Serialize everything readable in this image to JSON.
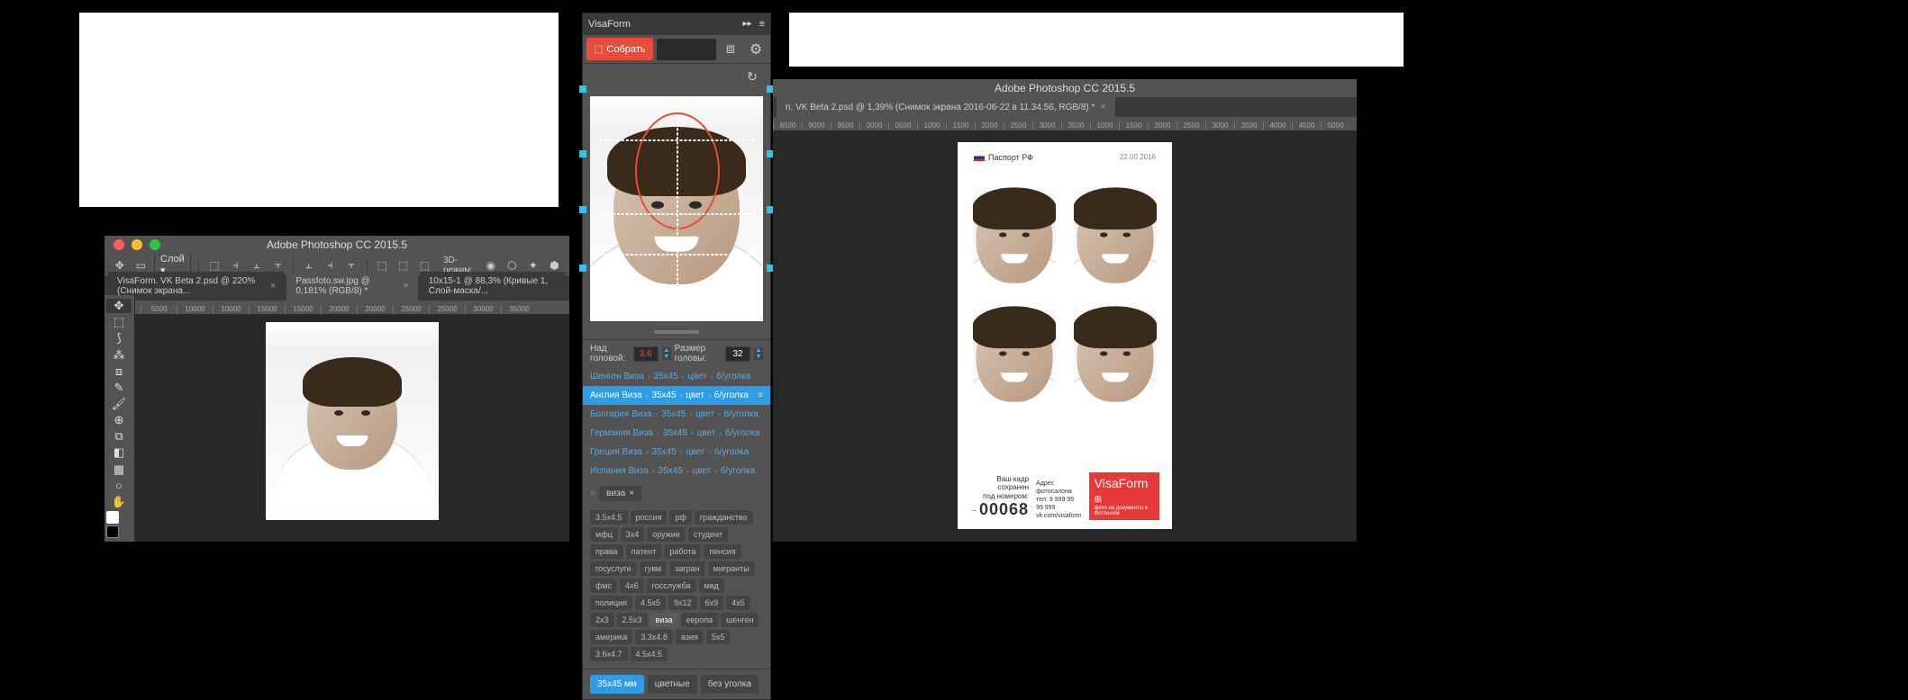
{
  "white_boxes": {},
  "ps_left": {
    "title": "Adobe Photoshop CC 2015.5",
    "layer_label": "Слой",
    "mode_label": "3D-режим:",
    "tabs": [
      "VisaForm. VK Beta 2.psd @ 220% (Снимок экрана...",
      "Passfoto.sw.jpg @ 0,181% (RGB/8) *",
      "10x15-1 @ 88,3% (Кривые 1, Слой-маска/..."
    ],
    "ruler": [
      "5000",
      "5000",
      "10000",
      "10000",
      "15000",
      "15000",
      "20000",
      "20000",
      "25000",
      "25000",
      "30000",
      "35000"
    ]
  },
  "ps_right": {
    "title": "Adobe Photoshop CC 2015.5",
    "tab": "n. VK Beta 2.psd @ 1,39% (Снимок экрана 2016-06-22 в 11.34.56, RGB/8) *",
    "ruler": [
      "8500",
      "9000",
      "9500",
      "0000",
      "0500",
      "1000",
      "1500",
      "2000",
      "2500",
      "3000",
      "3500",
      "1000",
      "1500",
      "2000",
      "2500",
      "3000",
      "3500",
      "4000",
      "4500",
      "5000"
    ]
  },
  "vf": {
    "title": "VisaForm",
    "build": "Собрать",
    "param_head_label": "Над головой:",
    "param_head_val": "3.6",
    "param_size_label": "Размер головы:",
    "param_size_val": "32",
    "rows": [
      {
        "name": "Шенген Виза",
        "size": "35x45",
        "color": "цвет",
        "corner": "б/уголка"
      },
      {
        "name": "Англия Виза",
        "size": "35x45",
        "color": "цвет",
        "corner": "б/уголка"
      },
      {
        "name": "Болгария Виза",
        "size": "35x45",
        "color": "цвет",
        "corner": "б/уголка"
      },
      {
        "name": "Германия Виза",
        "size": "35x45",
        "color": "цвет",
        "corner": "б/уголка"
      },
      {
        "name": "Греция Виза",
        "size": "35x45",
        "color": "цвет",
        "corner": "б/уголка"
      },
      {
        "name": "Испания Виза",
        "size": "35x45",
        "color": "цвет",
        "corner": "б/уголка"
      }
    ],
    "search_chip": "виза",
    "tags": [
      "3.5x4.5",
      "россия",
      "рф",
      "гражданство",
      "мфц",
      "3x4",
      "оружие",
      "студент",
      "права",
      "патент",
      "работа",
      "пенсия",
      "госуслуги",
      "гувм",
      "загран",
      "мигранты",
      "фмс",
      "4x6",
      "госслужба",
      "мвд",
      "полиция",
      "4.5x5",
      "9x12",
      "6x9",
      "4x5",
      "2x3",
      "2.5x3",
      "виза",
      "европа",
      "шенген",
      "америка",
      "3.3x4.8",
      "азия",
      "5x5",
      "3.6x4.7",
      "4.5x4.5"
    ],
    "tag_hl": "виза",
    "footer": {
      "size": "35x45 мм",
      "color": "цветные",
      "corner": "без уголка"
    }
  },
  "sheet": {
    "doc_type": "Паспорт РФ",
    "time": "22.00.2016",
    "saved_l1": "Ваш кадр сохранен",
    "saved_l2": "под номером:",
    "num": "00068",
    "addr_l1": "Адрес фотосалона",
    "addr_l2": "тел: 9 999 99 99 999",
    "addr_l3": "vk.com/visaform",
    "logo_main": "Visa",
    "logo_sub": "Form",
    "logo_tag": "фото на документы в Фотошопе"
  }
}
